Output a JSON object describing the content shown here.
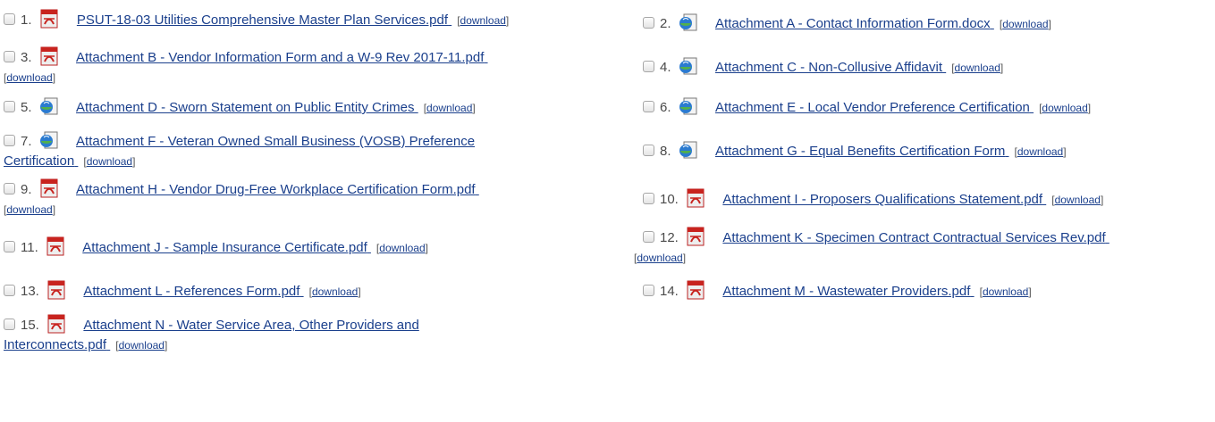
{
  "download_label": "download",
  "items": [
    {
      "num": "1.",
      "icon": "pdf-icon",
      "name": "PSUT-18-03 Utilities Comprehensive Master Plan Services.pdf"
    },
    {
      "num": "2.",
      "icon": "word-doc-icon",
      "name": "Attachment A - Contact Information Form.docx"
    },
    {
      "num": "3.",
      "icon": "pdf-icon",
      "name": "Attachment B - Vendor Information Form and a W-9 Rev 2017-11.pdf"
    },
    {
      "num": "4.",
      "icon": "word-doc-icon",
      "name": "Attachment C - Non-Collusive Affidavit"
    },
    {
      "num": "5.",
      "icon": "word-doc-icon",
      "name": "Attachment D - Sworn Statement on Public Entity Crimes"
    },
    {
      "num": "6.",
      "icon": "word-doc-icon",
      "name": "Attachment E - Local Vendor Preference Certification"
    },
    {
      "num": "7.",
      "icon": "word-doc-icon",
      "name": "Attachment F - Veteran Owned Small Business (VOSB) Preference Certification"
    },
    {
      "num": "8.",
      "icon": "word-doc-icon",
      "name": "Attachment G - Equal Benefits Certification Form"
    },
    {
      "num": "9.",
      "icon": "pdf-icon",
      "name": "Attachment H - Vendor Drug-Free Workplace Certification Form.pdf"
    },
    {
      "num": "10.",
      "icon": "pdf-icon",
      "name": "Attachment I - Proposers Qualifications Statement.pdf"
    },
    {
      "num": "11.",
      "icon": "pdf-icon",
      "name": "Attachment J - Sample Insurance Certificate.pdf"
    },
    {
      "num": "12.",
      "icon": "pdf-icon",
      "name": "Attachment K - Specimen Contract Contractual Services Rev.pdf"
    },
    {
      "num": "13.",
      "icon": "pdf-icon",
      "name": "Attachment L - References Form.pdf"
    },
    {
      "num": "14.",
      "icon": "pdf-icon",
      "name": "Attachment M - Wastewater Providers.pdf"
    },
    {
      "num": "15.",
      "icon": "pdf-icon",
      "name": "Attachment N - Water Service Area, Other Providers and Interconnects.pdf"
    }
  ]
}
